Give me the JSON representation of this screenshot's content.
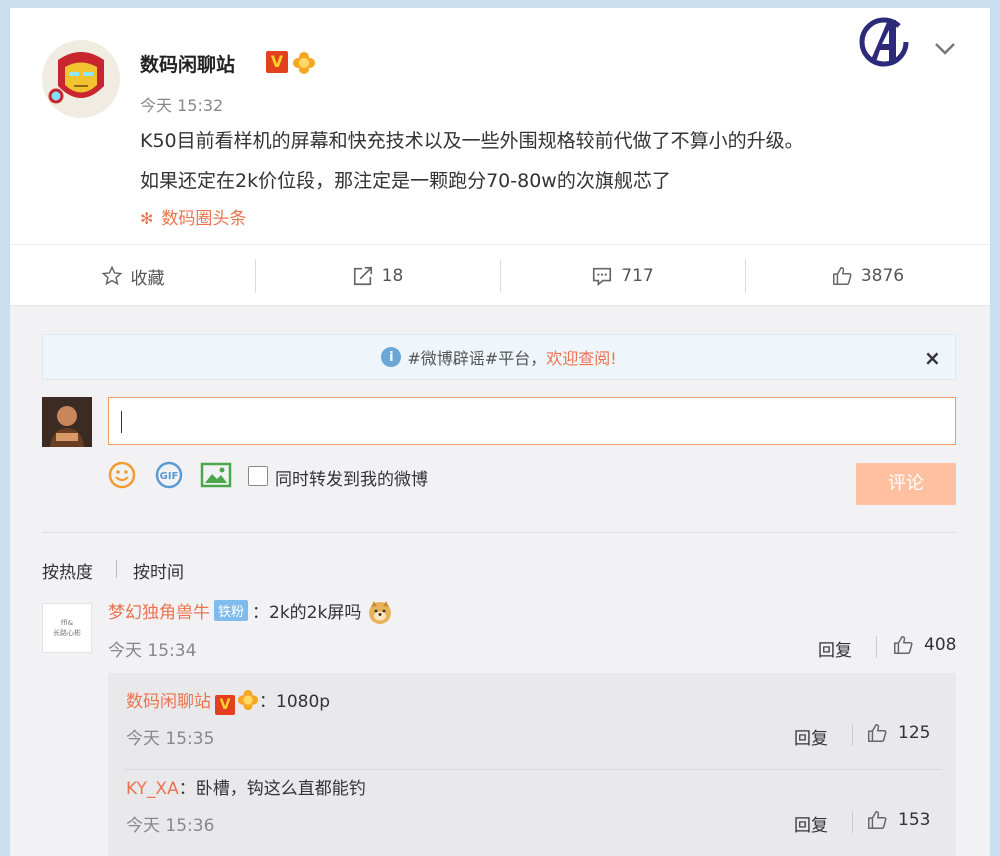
{
  "post": {
    "author": "数码闲聊站",
    "time": "今天 15:32",
    "line1": "K50目前看样机的屏幕和快充技术以及一些外围规格较前代做了不算小的升级。",
    "line2": "如果还定在2k价位段，那注定是一颗跑分70-80w的次旗舰芯了",
    "source_label": "数码圈头条"
  },
  "actions": {
    "favorite": "收藏",
    "repost_count": "18",
    "comment_count": "717",
    "like_count": "3876"
  },
  "notice": {
    "prefix": "#微博辟谣#平台，",
    "highlight": "欢迎查阅!",
    "close": "×"
  },
  "composer": {
    "input_value": "",
    "sync_label": "同时转发到我的微博",
    "submit_label": "评论"
  },
  "sort": {
    "by_hot": "按热度",
    "by_time": "按时间"
  },
  "comments": [
    {
      "user": "梦幻独角兽牛",
      "badge": "铁粉",
      "text": "：2k的2k屏吗",
      "time": "今天 15:34",
      "reply_label": "回复",
      "likes": "408",
      "avatar_text_1": "ffl&",
      "avatar_text_2": "长路心彬"
    }
  ],
  "replies": [
    {
      "user": "数码闲聊站",
      "text": "：1080p",
      "time": "今天 15:35",
      "reply_label": "回复",
      "likes": "125"
    },
    {
      "user": "KY_XA",
      "text": "：卧槽，钩这么直都能钓",
      "time": "今天 15:36",
      "reply_label": "回复",
      "likes": "153"
    }
  ],
  "colors": {
    "accent": "#eb7350",
    "page_bg": "#c9dff0",
    "submit_bg": "#ffc09f",
    "notice_bg": "#eef6fc"
  }
}
